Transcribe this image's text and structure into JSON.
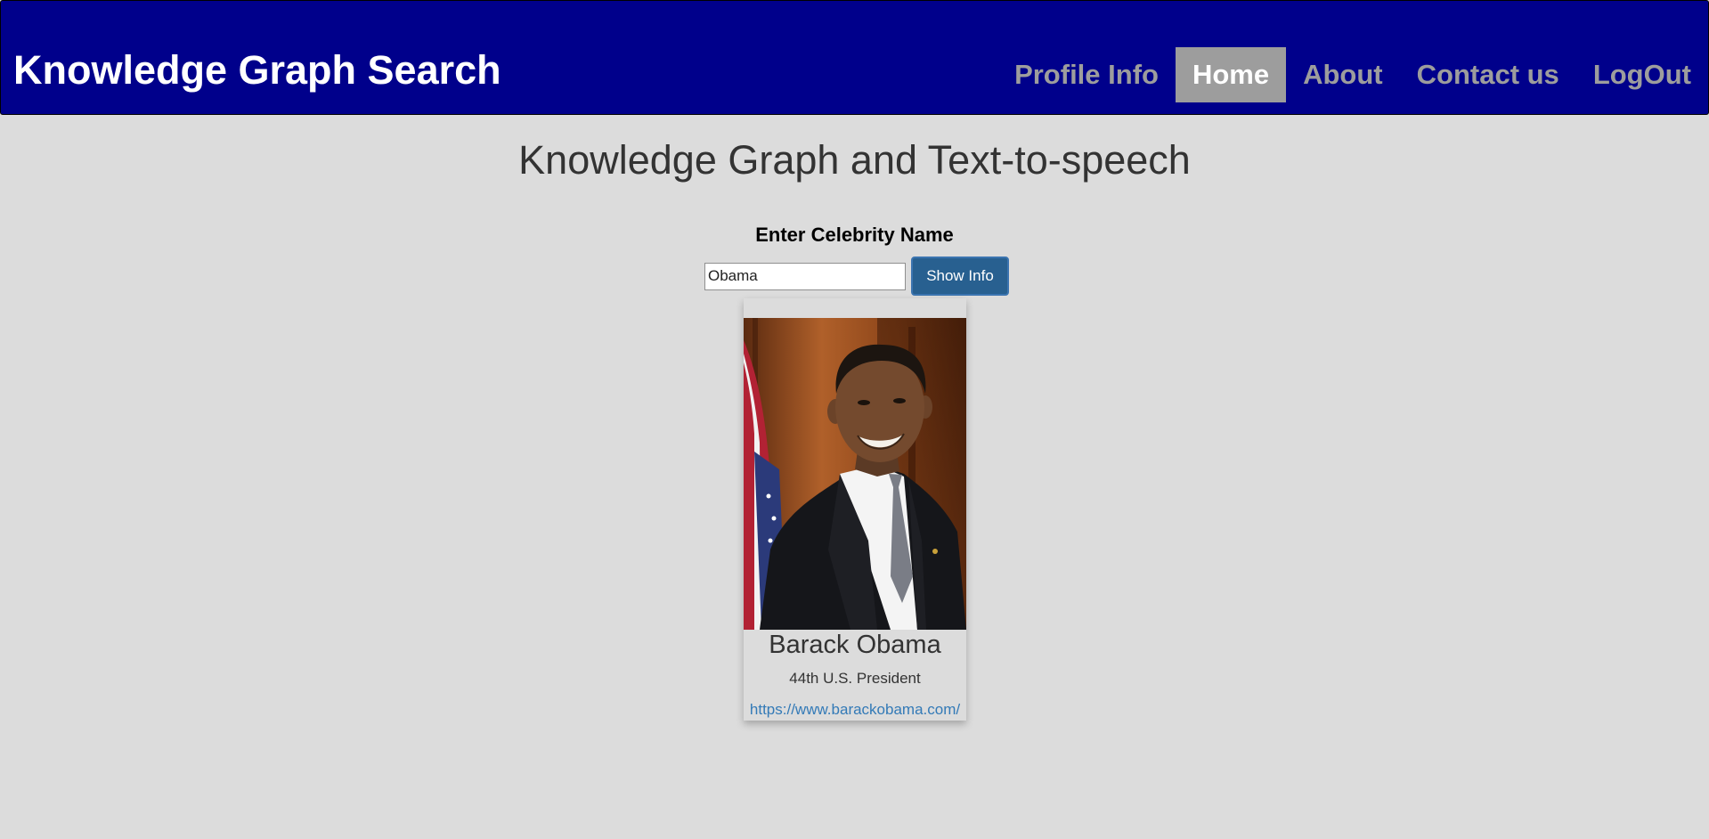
{
  "header": {
    "brand": "Knowledge Graph Search",
    "nav": [
      {
        "label": "Profile Info",
        "active": false
      },
      {
        "label": "Home",
        "active": true
      },
      {
        "label": "About",
        "active": false
      },
      {
        "label": "Contact us",
        "active": false
      },
      {
        "label": "LogOut",
        "active": false
      }
    ]
  },
  "main": {
    "title": "Knowledge Graph and Text-to-speech",
    "form": {
      "label": "Enter Celebrity Name",
      "input_value": "Obama",
      "button_label": "Show Info"
    },
    "result_card": {
      "name": "Barack Obama",
      "description": "44th U.S. President",
      "url": "https://www.barackobama.com/"
    }
  },
  "colors": {
    "navbar_bg": "#00008b",
    "nav_active_bg": "#9d9d9d",
    "button_bg": "#286090",
    "link": "#337ab7",
    "page_bg": "#dcdcdc"
  }
}
